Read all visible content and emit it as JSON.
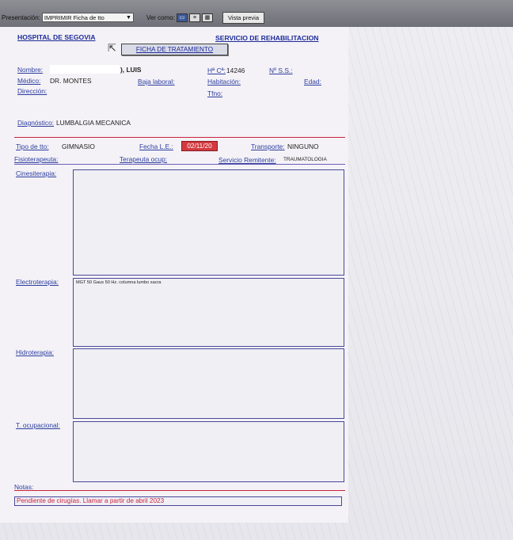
{
  "toolbar": {
    "presentation_label": "Presentación:",
    "presentation_value": "IMPRIMIR Ficha de tto",
    "view_as_label": "Ver como:",
    "preview_button": "Vista previa"
  },
  "header": {
    "hospital": "HOSPITAL DE SEGOVIA",
    "service": "SERVICIO DE REHABILITACION",
    "form_button": "FICHA DE TRATAMIENTO"
  },
  "patient": {
    "nombre_label": "Nombre:",
    "nombre_value": "), LUIS",
    "hc_label": "Hª Cª:",
    "hc_value": "14246",
    "ss_label": "Nº S.S.:",
    "medico_label": "Médico:",
    "medico_value": "DR. MONTES",
    "baja_label": "Baja laboral:",
    "habitacion_label": "Habitación:",
    "edad_label": "Edad:",
    "direccion_label": "Dirección:",
    "tfno_label": "Tfno:",
    "diagnostico_label": "Diagnóstico:",
    "diagnostico_value": "LUMBALGIA MECANICA"
  },
  "treatment": {
    "tipo_label": "Tipo de tto:",
    "tipo_value": "GIMNASIO",
    "fecha_label": "Fecha L.E.:",
    "fecha_value": "02/11/20",
    "transporte_label": "Transporte:",
    "transporte_value": "NINGUNO",
    "fisio_label": "Fisioterapeuta:",
    "terapeuta_label": "Terapeuta ocup:",
    "servicio_label": "Servicio Remitente:",
    "servicio_value": "TRAUMATOLOGIA"
  },
  "sections": {
    "cinesiterapia_label": "Cinesiterapia:",
    "cinesiterapia_value": "",
    "electroterapia_label": "Electroterapia:",
    "electroterapia_value": "MGT 50 Gaus 50 Hz. columna lumbo sacra",
    "hidroterapia_label": "Hidroterapia:",
    "hidroterapia_value": "",
    "ocupacional_label": "T. ocupacional:",
    "ocupacional_value": ""
  },
  "notes": {
    "label": "Notas:",
    "value": "Pendiente de cirugías. Llamar a partir de abril 2023"
  },
  "colors": {
    "label_blue": "#2d3ea0",
    "red_accent": "#c9243a",
    "box_border": "#48489a"
  }
}
